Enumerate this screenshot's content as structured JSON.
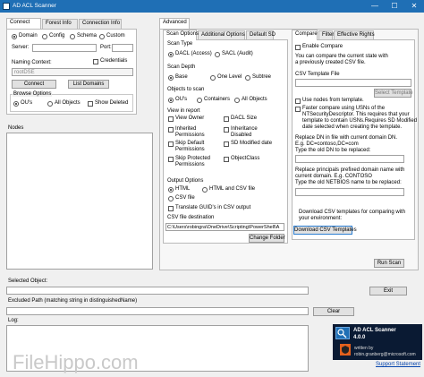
{
  "window": {
    "title": "AD ACL Scanner",
    "controls": {
      "minimize": "—",
      "maximize": "☐",
      "close": "✕"
    }
  },
  "left_tabs": [
    "Connect",
    "Forest Info",
    "Connection Info"
  ],
  "connect": {
    "mode_options": [
      "Domain",
      "Config",
      "Schema",
      "Custom"
    ],
    "selected_mode": "Domain",
    "server_label": "Server:",
    "port_label": "Port:",
    "credentials_label": "Credentials",
    "naming_context_label": "Naming Context:",
    "naming_context_value": "rootDSE",
    "connect_button": "Connect",
    "list_domains_button": "List Domains",
    "browse_options_title": "Browse Options",
    "browse_options": [
      "OU's",
      "All Objects"
    ],
    "selected_browse": "OU's",
    "show_deleted_label": "Show Deleted"
  },
  "nodes_label": "Nodes",
  "advanced_tab": "Advanced",
  "mid_tabs": [
    "Scan Options",
    "Additional Options",
    "Default SD"
  ],
  "scan": {
    "scan_type_title": "Scan Type",
    "scan_types": [
      "DACL (Access)",
      "SACL (Audit)"
    ],
    "selected_type": "DACL (Access)",
    "scan_depth_title": "Scan Depth",
    "depths": [
      "Base",
      "One Level",
      "Subtree"
    ],
    "selected_depth": "Base",
    "objects_title": "Objects to scan",
    "objects": [
      "OU's",
      "Containers",
      "All Objects"
    ],
    "selected_object": "OU's",
    "view_title": "View in report",
    "view_items": [
      "View Owner",
      "DACL Size",
      "Inherited Permissions",
      "Inheritance Disabled",
      "Skip Default Permissions",
      "SD Modified date",
      "Skip Protected Permissions",
      "ObjectClass"
    ],
    "output_title": "Output Options",
    "outputs": [
      "HTML",
      "HTML and CSV file",
      "CSV file"
    ],
    "selected_output": "HTML",
    "translate_label": "Translate GUID's in CSV output",
    "csv_dest_label": "CSV file destination",
    "csv_dest_value": "C:\\Users\\robingra\\OneDrive\\Scripting\\PowerShell\\A",
    "change_folder_button": "Change Folder"
  },
  "right_tabs": [
    "Compare",
    "Filter",
    "Effective Rights"
  ],
  "compare": {
    "enable_label": "Enable Compare",
    "desc": [
      "You can compare the current state with",
      "a previously created CSV file."
    ],
    "template_label": "CSV Template File",
    "select_template_button": "Select Template",
    "use_nodes_label": "Use nodes from template.",
    "faster_lines": [
      "Faster compare using USNs of the",
      "NTSecurityDescriptor. This requires that your",
      "template to contain USNs.Requires SD Modified",
      "date selected when creating the template."
    ],
    "replace_dn_lines": [
      "Replace DN in file with current domain DN.",
      "E.g. DC=contoso,DC=com",
      "Type the old DN to be replaced:"
    ],
    "replace_principal_lines": [
      "Replace principals prefixed domain name with",
      "current domain. E.g. CONTOSO",
      "Type the old NETBIOS name to be replaced:"
    ],
    "download_lines": [
      "Download CSV templates for comparing with",
      "your environment:"
    ],
    "download_button": "Download CSV Templates"
  },
  "run_scan_button": "Run Scan",
  "selected_object_label": "Selected Object:",
  "exit_button": "Exit",
  "excluded_label": "Excluded Path (matching string in distinguishedName)",
  "clear_button": "Clear",
  "log_label": "Log:",
  "about": {
    "title": "AD ACL Scanner",
    "version": "4.0.0",
    "written_by": "written by",
    "email": "robin.granberg@microsoft.com",
    "support": "Support Statement"
  },
  "watermark": "FileHippo.com"
}
